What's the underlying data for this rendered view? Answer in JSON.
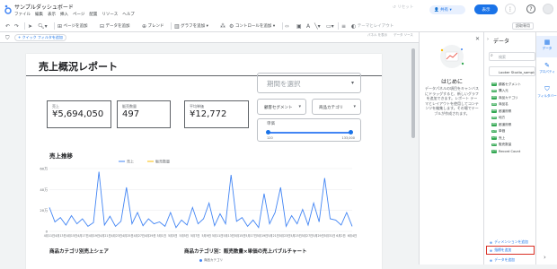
{
  "app": {
    "title": "サンプルダッシュボード",
    "menu": [
      "ファイル",
      "編集",
      "表示",
      "挿入",
      "ページ",
      "配置",
      "リソース",
      "ヘルプ"
    ],
    "reset_label": "リセット",
    "share_label": "共有",
    "view_label": "表示",
    "more_label": "⋮",
    "help_label": "?"
  },
  "toolbar": {
    "add_page": "ページを追加",
    "add_data": "データを追加",
    "blend": "ブレンド",
    "add_chart": "グラフを追加",
    "add_control": "コントロールを追加",
    "theme_layout": "テーマとレイアウト",
    "readonly": "読取専用"
  },
  "filterbar": {
    "quick_filter": "+ クイック フィルタを追加",
    "control1_label": "パネル\nを表示",
    "control2_label": "データ\nソース"
  },
  "report": {
    "title": "売上概況レポート",
    "kpis": [
      {
        "label": "売上",
        "value": "¥5,694,050"
      },
      {
        "label": "販売数量",
        "value": "497"
      },
      {
        "label": "平均単価",
        "value": "¥12,772"
      }
    ],
    "date_picker": "期間を選択",
    "dropdowns": [
      "顧客セグメント",
      "商品カテゴリ"
    ],
    "slider": {
      "label": "単価",
      "min": "120",
      "max": "133,000",
      "low": 0.0,
      "high": 1.0
    },
    "trend_title": "売上推移",
    "section_titles": [
      "商品カテゴリ別売上シェア",
      "商品カテゴリ別：販売数量×単価の売上バブルチャート"
    ],
    "bubble_legend": "商品カテゴリ"
  },
  "chart_data": {
    "type": "line",
    "title": "売上推移",
    "series": [
      {
        "name": "売上",
        "color": "#4285f4",
        "values": [
          38,
          15,
          22,
          10,
          25,
          12,
          20,
          8,
          14,
          95,
          10,
          24,
          8,
          16,
          70,
          12,
          30,
          9,
          20,
          12,
          15,
          8,
          30,
          6,
          18,
          10,
          38,
          12,
          20,
          45,
          9,
          28,
          12,
          90,
          16,
          22,
          8,
          18,
          6,
          60,
          12,
          30,
          70,
          8,
          25,
          12,
          35,
          10,
          45,
          15,
          85,
          20,
          18,
          10,
          30,
          8
        ]
      },
      {
        "name": "販売数量",
        "color": "#fbbc04",
        "values": []
      }
    ],
    "x_ticks": [
      "4月11日",
      "4月13日",
      "4月15日",
      "4月17日",
      "4月19日",
      "4月21日",
      "4月23日",
      "4月25日",
      "4月27日",
      "4月29日",
      "5月1日",
      "5月3日",
      "5月5日",
      "5月7日",
      "5月9日",
      "5月11日",
      "5月13日",
      "5月15日",
      "5月17日",
      "5月19日",
      "5月21日",
      "5月23日",
      "5月25日",
      "5月27日",
      "5月29日",
      "5月31日",
      "6月2日",
      "6月4日"
    ],
    "y_ticks": [
      "60万",
      "40万",
      "20万",
      "0"
    ],
    "ylim": [
      0,
      600000
    ]
  },
  "onboarding": {
    "title": "はじめに",
    "body": "データパネルの項目をキャンバスにドラッグすると、新しいグラフを追加できます。レポート テーマとレイアウトを使用してコンテンツを編集します。その場でテーブルが作成されます。"
  },
  "datapanel": {
    "header": "データ",
    "search_placeholder": "検索",
    "source": "Looker Studio_sample...",
    "fields": [
      {
        "tag": "ABC",
        "name": "顧客セグメント"
      },
      {
        "tag": "ABC",
        "name": "購入元"
      },
      {
        "tag": "ABC",
        "name": "商品カテゴリ"
      },
      {
        "tag": "ABC",
        "name": "商品名"
      },
      {
        "tag": "ABC",
        "name": "都道府県"
      },
      {
        "tag": "ABC",
        "name": "地方"
      },
      {
        "tag": "ABC",
        "name": "都道府県"
      },
      {
        "tag": "123",
        "name": "単価"
      },
      {
        "tag": "123",
        "name": "売上"
      },
      {
        "tag": "123",
        "name": "販売数量"
      },
      {
        "tag": "123",
        "name": "Record Count"
      }
    ],
    "add_dimension": "ディメンションを追加",
    "add_metric": "指標を追加",
    "add_param": "データを追加"
  },
  "rail": {
    "items": [
      {
        "label": "データ",
        "icon": "table-icon"
      },
      {
        "label": "プロパティ",
        "icon": "pencil-icon"
      },
      {
        "label": "フィルタバー",
        "icon": "filter-icon"
      }
    ]
  },
  "colors": {
    "accent": "#1a73e8",
    "highlight": "#d93025",
    "line_sales": "#4285f4",
    "line_qty": "#fbbc04"
  }
}
